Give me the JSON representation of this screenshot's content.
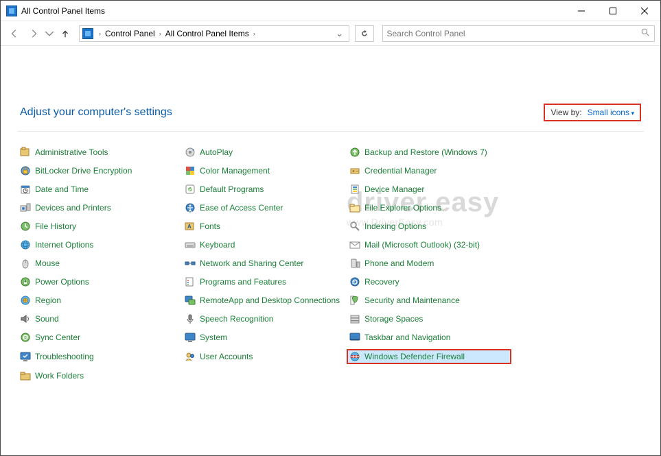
{
  "window": {
    "title": "All Control Panel Items"
  },
  "breadcrumb": {
    "root": "Control Panel",
    "current": "All Control Panel Items"
  },
  "search": {
    "placeholder": "Search Control Panel"
  },
  "heading": "Adjust your computer's settings",
  "viewby": {
    "label": "View by:",
    "value": "Small icons"
  },
  "items": {
    "col1": [
      {
        "label": "Administrative Tools",
        "icon": "admin-tools-icon"
      },
      {
        "label": "BitLocker Drive Encryption",
        "icon": "bitlocker-icon"
      },
      {
        "label": "Date and Time",
        "icon": "datetime-icon"
      },
      {
        "label": "Devices and Printers",
        "icon": "devices-icon"
      },
      {
        "label": "File History",
        "icon": "filehistory-icon"
      },
      {
        "label": "Internet Options",
        "icon": "internet-icon"
      },
      {
        "label": "Mouse",
        "icon": "mouse-icon"
      },
      {
        "label": "Power Options",
        "icon": "power-icon"
      },
      {
        "label": "Region",
        "icon": "region-icon"
      },
      {
        "label": "Sound",
        "icon": "sound-icon"
      },
      {
        "label": "Sync Center",
        "icon": "sync-icon"
      },
      {
        "label": "Troubleshooting",
        "icon": "troubleshoot-icon"
      },
      {
        "label": "Work Folders",
        "icon": "workfolders-icon"
      }
    ],
    "col2": [
      {
        "label": "AutoPlay",
        "icon": "autoplay-icon"
      },
      {
        "label": "Color Management",
        "icon": "color-icon"
      },
      {
        "label": "Default Programs",
        "icon": "default-icon"
      },
      {
        "label": "Ease of Access Center",
        "icon": "ease-icon"
      },
      {
        "label": "Fonts",
        "icon": "fonts-icon"
      },
      {
        "label": "Keyboard",
        "icon": "keyboard-icon"
      },
      {
        "label": "Network and Sharing Center",
        "icon": "network-icon"
      },
      {
        "label": "Programs and Features",
        "icon": "programs-icon"
      },
      {
        "label": "RemoteApp and Desktop Connections",
        "icon": "remote-icon"
      },
      {
        "label": "Speech Recognition",
        "icon": "speech-icon"
      },
      {
        "label": "System",
        "icon": "system-icon"
      },
      {
        "label": "User Accounts",
        "icon": "users-icon"
      }
    ],
    "col3": [
      {
        "label": "Backup and Restore (Windows 7)",
        "icon": "backup-icon"
      },
      {
        "label": "Credential Manager",
        "icon": "credential-icon"
      },
      {
        "label": "Device Manager",
        "icon": "devicemgr-icon"
      },
      {
        "label": "File Explorer Options",
        "icon": "explorer-icon"
      },
      {
        "label": "Indexing Options",
        "icon": "indexing-icon"
      },
      {
        "label": "Mail (Microsoft Outlook) (32-bit)",
        "icon": "mail-icon"
      },
      {
        "label": "Phone and Modem",
        "icon": "phone-icon"
      },
      {
        "label": "Recovery",
        "icon": "recovery-icon"
      },
      {
        "label": "Security and Maintenance",
        "icon": "security-icon"
      },
      {
        "label": "Storage Spaces",
        "icon": "storage-icon"
      },
      {
        "label": "Taskbar and Navigation",
        "icon": "taskbar-icon"
      },
      {
        "label": "Windows Defender Firewall",
        "icon": "firewall-icon",
        "highlight": true,
        "selected": true
      }
    ]
  },
  "watermark": {
    "brand": "driver easy",
    "url": "www.DriverEasy.com"
  }
}
